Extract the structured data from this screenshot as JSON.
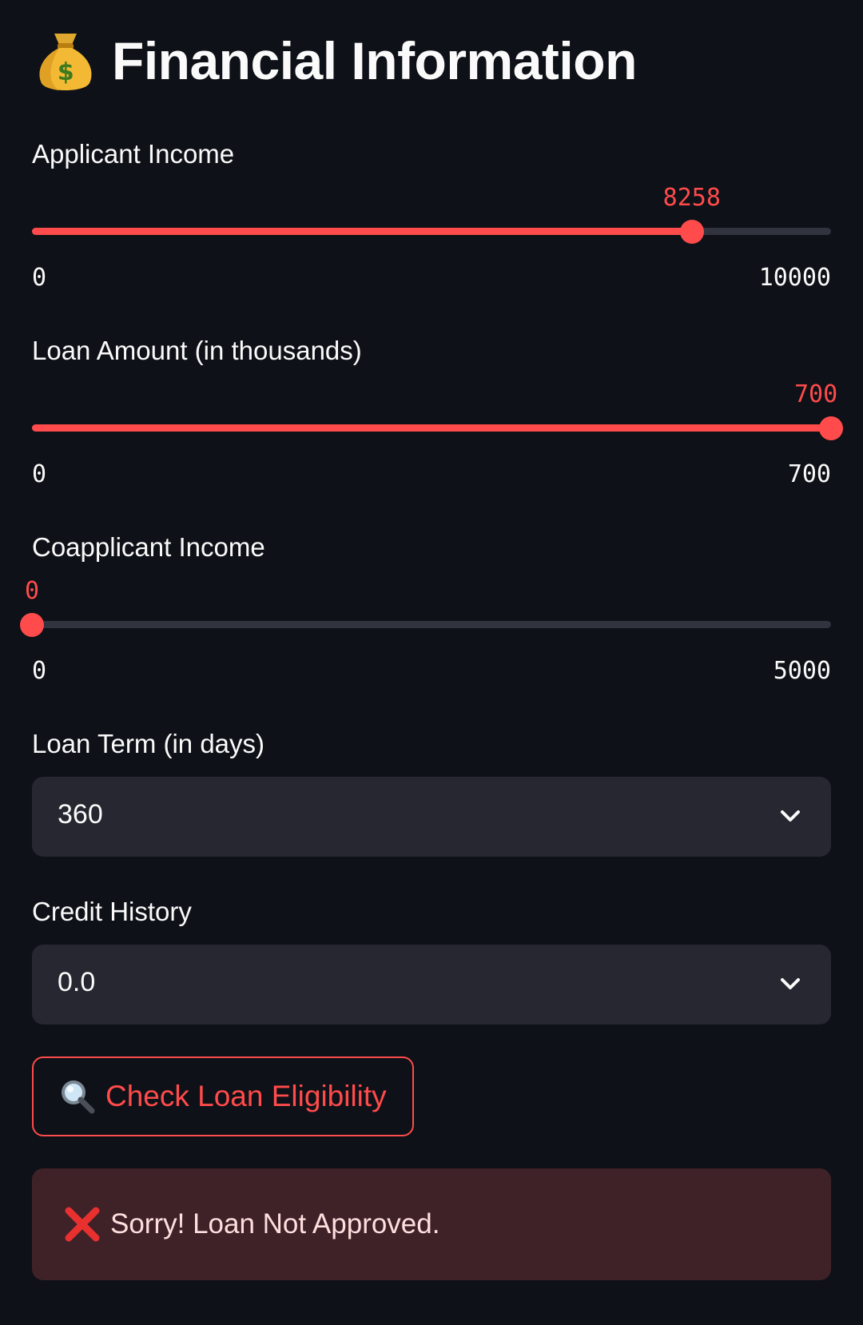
{
  "header": {
    "icon": "money-bag-icon",
    "title": "Financial Information"
  },
  "fields": {
    "applicant_income": {
      "label": "Applicant Income",
      "value": "8258",
      "min": "0",
      "max": "10000",
      "fraction": 0.8258
    },
    "loan_amount": {
      "label": "Loan Amount (in thousands)",
      "value": "700",
      "min": "0",
      "max": "700",
      "fraction": 1.0
    },
    "coapplicant_income": {
      "label": "Coapplicant Income",
      "value": "0",
      "min": "0",
      "max": "5000",
      "fraction": 0.0
    },
    "loan_term": {
      "label": "Loan Term (in days)",
      "selected": "360"
    },
    "credit_history": {
      "label": "Credit History",
      "selected": "0.0"
    }
  },
  "actions": {
    "check_button": {
      "icon": "magnifier-icon",
      "label": "Check Loan Eligibility"
    }
  },
  "result": {
    "icon": "cross-mark-icon",
    "message": "Sorry! Loan Not Approved."
  },
  "colors": {
    "background": "#0e1117",
    "accent": "#ff4b4b",
    "input_background": "#262730",
    "error_background": "#3e2228"
  }
}
